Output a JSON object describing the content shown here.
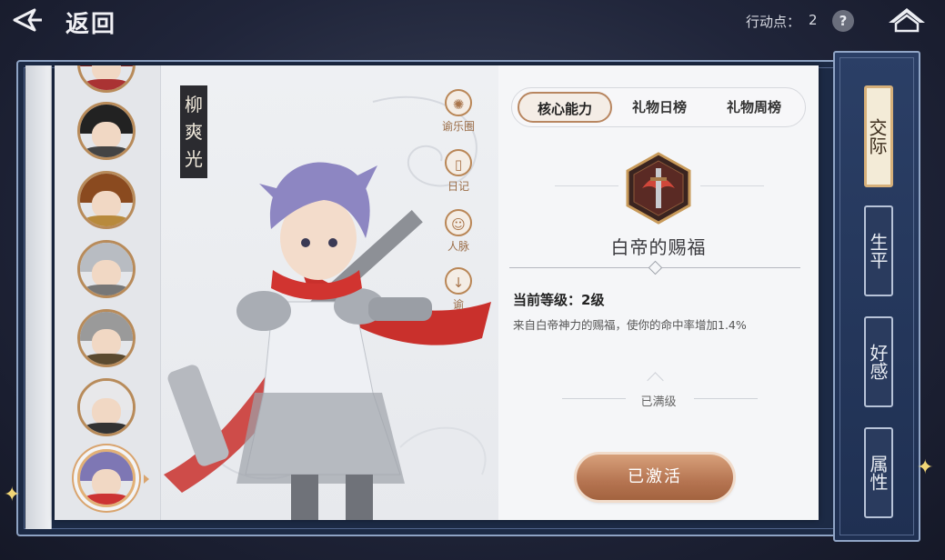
{
  "topbar": {
    "back_label": "返回",
    "action_points_label": "行动点：",
    "action_points_value": "2",
    "help_symbol": "?",
    "icons": [
      "back-arrow-icon",
      "help-icon",
      "home-icon"
    ]
  },
  "character": {
    "name": "柳爽光",
    "portraits": [
      "hero-portrait-red-hair",
      "hero-portrait-black-hair",
      "hero-portrait-brown-hair",
      "hero-portrait-silver-hair",
      "hero-portrait-elder-beard",
      "hero-portrait-white-hair",
      "hero-portrait-purple-hair"
    ],
    "selected_portrait_index": 6
  },
  "side_tools": [
    {
      "label": "谕乐圈",
      "icon": "circle-swirl-icon"
    },
    {
      "label": "日记",
      "icon": "diary-icon"
    },
    {
      "label": "人脉",
      "icon": "people-icon"
    },
    {
      "label": "谕",
      "icon": "download-icon"
    }
  ],
  "tabs": [
    "核心能力",
    "礼物日榜",
    "礼物周榜"
  ],
  "active_tab_index": 0,
  "skill": {
    "icon": "sword-emblem-icon",
    "name": "白帝的赐福",
    "level_text": "当前等级：2级",
    "description": "来自白帝神力的赐福，使你的命中率增加1.4%",
    "max_label": "已满级",
    "button_label": "已激活"
  },
  "right_nav": [
    "交际",
    "生平",
    "好感",
    "属性"
  ],
  "right_nav_active_index": 0,
  "colors": {
    "accent_bronze": "#b57451",
    "book_blue": "#1f3052",
    "page": "#f5f6f8"
  }
}
